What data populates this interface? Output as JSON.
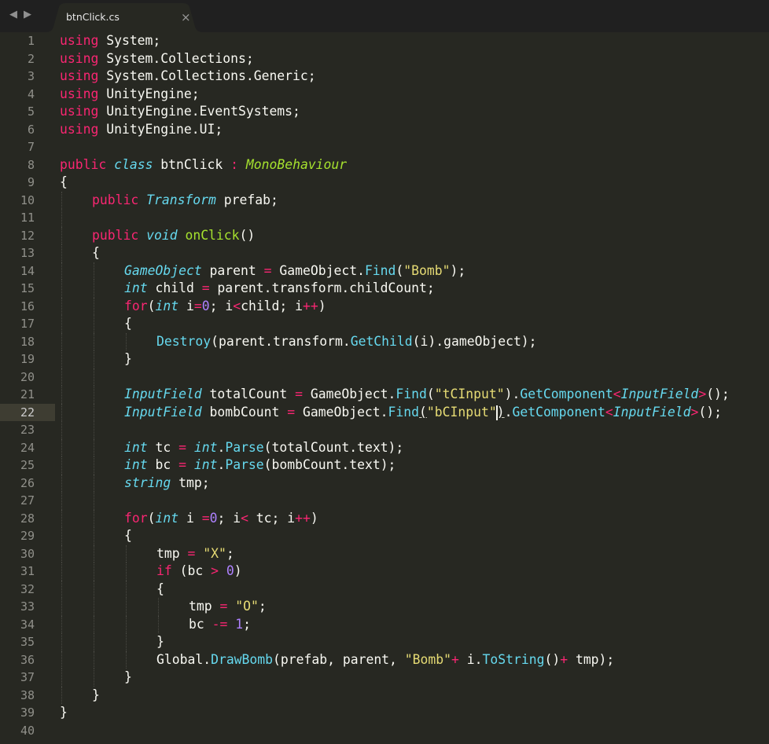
{
  "tabbar": {
    "nav_left_icon": "◀",
    "nav_right_icon": "▶",
    "active_tab": "btnClick.cs",
    "close_glyph": "×"
  },
  "editor": {
    "current_line": 22,
    "lines": [
      {
        "n": "1",
        "indent": 0,
        "tokens": [
          {
            "t": "using",
            "c": "k"
          },
          {
            "t": " System;",
            "c": "p"
          }
        ]
      },
      {
        "n": "2",
        "indent": 0,
        "tokens": [
          {
            "t": "using",
            "c": "k"
          },
          {
            "t": " System.Collections;",
            "c": "p"
          }
        ]
      },
      {
        "n": "3",
        "indent": 0,
        "tokens": [
          {
            "t": "using",
            "c": "k"
          },
          {
            "t": " System.Collections.Generic;",
            "c": "p"
          }
        ]
      },
      {
        "n": "4",
        "indent": 0,
        "tokens": [
          {
            "t": "using",
            "c": "k"
          },
          {
            "t": " UnityEngine;",
            "c": "p"
          }
        ]
      },
      {
        "n": "5",
        "indent": 0,
        "tokens": [
          {
            "t": "using",
            "c": "k"
          },
          {
            "t": " UnityEngine.EventSystems;",
            "c": "p"
          }
        ]
      },
      {
        "n": "6",
        "indent": 0,
        "tokens": [
          {
            "t": "using",
            "c": "k"
          },
          {
            "t": " UnityEngine.UI;",
            "c": "p"
          }
        ]
      },
      {
        "n": "7",
        "indent": 0,
        "tokens": []
      },
      {
        "n": "8",
        "indent": 0,
        "tokens": [
          {
            "t": "public",
            "c": "k"
          },
          {
            "t": " ",
            "c": "p"
          },
          {
            "t": "class",
            "c": "t"
          },
          {
            "t": " btnClick ",
            "c": "p"
          },
          {
            "t": ":",
            "c": "o"
          },
          {
            "t": " ",
            "c": "p"
          },
          {
            "t": "MonoBehaviour",
            "c": "c"
          }
        ]
      },
      {
        "n": "9",
        "indent": 0,
        "tokens": [
          {
            "t": "{",
            "c": "p"
          }
        ]
      },
      {
        "n": "10",
        "indent": 1,
        "tokens": [
          {
            "t": "public",
            "c": "k"
          },
          {
            "t": " ",
            "c": "p"
          },
          {
            "t": "Transform",
            "c": "t"
          },
          {
            "t": " prefab;",
            "c": "p"
          }
        ]
      },
      {
        "n": "11",
        "indent": 1,
        "tokens": []
      },
      {
        "n": "12",
        "indent": 1,
        "tokens": [
          {
            "t": "public",
            "c": "k"
          },
          {
            "t": " ",
            "c": "p"
          },
          {
            "t": "void",
            "c": "t"
          },
          {
            "t": " ",
            "c": "p"
          },
          {
            "t": "onClick",
            "c": "cn"
          },
          {
            "t": "()",
            "c": "p"
          }
        ]
      },
      {
        "n": "13",
        "indent": 1,
        "tokens": [
          {
            "t": "{",
            "c": "p"
          }
        ]
      },
      {
        "n": "14",
        "indent": 2,
        "tokens": [
          {
            "t": "GameObject",
            "c": "t"
          },
          {
            "t": " parent ",
            "c": "p"
          },
          {
            "t": "=",
            "c": "o"
          },
          {
            "t": " GameObject.",
            "c": "p"
          },
          {
            "t": "Find",
            "c": "f"
          },
          {
            "t": "(",
            "c": "p"
          },
          {
            "t": "\"Bomb\"",
            "c": "s"
          },
          {
            "t": ");",
            "c": "p"
          }
        ]
      },
      {
        "n": "15",
        "indent": 2,
        "tokens": [
          {
            "t": "int",
            "c": "t"
          },
          {
            "t": " child ",
            "c": "p"
          },
          {
            "t": "=",
            "c": "o"
          },
          {
            "t": " parent.transform.childCount;",
            "c": "p"
          }
        ]
      },
      {
        "n": "16",
        "indent": 2,
        "tokens": [
          {
            "t": "for",
            "c": "k"
          },
          {
            "t": "(",
            "c": "p"
          },
          {
            "t": "int",
            "c": "t"
          },
          {
            "t": " i",
            "c": "p"
          },
          {
            "t": "=",
            "c": "o"
          },
          {
            "t": "0",
            "c": "n"
          },
          {
            "t": "; i",
            "c": "p"
          },
          {
            "t": "<",
            "c": "o"
          },
          {
            "t": "child; i",
            "c": "p"
          },
          {
            "t": "++",
            "c": "o"
          },
          {
            "t": ")",
            "c": "p"
          }
        ]
      },
      {
        "n": "17",
        "indent": 2,
        "tokens": [
          {
            "t": "{",
            "c": "p"
          }
        ]
      },
      {
        "n": "18",
        "indent": 3,
        "tokens": [
          {
            "t": "Destroy",
            "c": "f"
          },
          {
            "t": "(parent.transform.",
            "c": "p"
          },
          {
            "t": "GetChild",
            "c": "f"
          },
          {
            "t": "(i).gameObject);",
            "c": "p"
          }
        ]
      },
      {
        "n": "19",
        "indent": 2,
        "tokens": [
          {
            "t": "}",
            "c": "p"
          }
        ]
      },
      {
        "n": "20",
        "indent": 2,
        "tokens": []
      },
      {
        "n": "21",
        "indent": 2,
        "tokens": [
          {
            "t": "InputField",
            "c": "t"
          },
          {
            "t": " totalCount ",
            "c": "p"
          },
          {
            "t": "=",
            "c": "o"
          },
          {
            "t": " GameObject.",
            "c": "p"
          },
          {
            "t": "Find",
            "c": "f"
          },
          {
            "t": "(",
            "c": "p"
          },
          {
            "t": "\"tCInput\"",
            "c": "s"
          },
          {
            "t": ").",
            "c": "p"
          },
          {
            "t": "GetComponent",
            "c": "f"
          },
          {
            "t": "<",
            "c": "o"
          },
          {
            "t": "InputField",
            "c": "t"
          },
          {
            "t": ">",
            "c": "o"
          },
          {
            "t": "();",
            "c": "p"
          }
        ]
      },
      {
        "n": "22",
        "indent": 2,
        "tokens": [
          {
            "t": "InputField",
            "c": "t"
          },
          {
            "t": " bombCount ",
            "c": "p"
          },
          {
            "t": "=",
            "c": "o"
          },
          {
            "t": " GameObject.",
            "c": "p"
          },
          {
            "t": "Find",
            "c": "f"
          },
          {
            "t": "(",
            "c": "p ul"
          },
          {
            "t": "\"bCInput\"",
            "c": "s"
          },
          {
            "t": ")",
            "c": "p ul"
          },
          {
            "t": ".",
            "c": "p"
          },
          {
            "t": "GetComponent",
            "c": "f"
          },
          {
            "t": "<",
            "c": "o"
          },
          {
            "t": "InputField",
            "c": "t"
          },
          {
            "t": ">",
            "c": "o"
          },
          {
            "t": "();",
            "c": "p"
          }
        ]
      },
      {
        "n": "23",
        "indent": 2,
        "tokens": []
      },
      {
        "n": "24",
        "indent": 2,
        "tokens": [
          {
            "t": "int",
            "c": "t"
          },
          {
            "t": " tc ",
            "c": "p"
          },
          {
            "t": "=",
            "c": "o"
          },
          {
            "t": " ",
            "c": "p"
          },
          {
            "t": "int",
            "c": "t"
          },
          {
            "t": ".",
            "c": "p"
          },
          {
            "t": "Parse",
            "c": "f"
          },
          {
            "t": "(totalCount.text);",
            "c": "p"
          }
        ]
      },
      {
        "n": "25",
        "indent": 2,
        "tokens": [
          {
            "t": "int",
            "c": "t"
          },
          {
            "t": " bc ",
            "c": "p"
          },
          {
            "t": "=",
            "c": "o"
          },
          {
            "t": " ",
            "c": "p"
          },
          {
            "t": "int",
            "c": "t"
          },
          {
            "t": ".",
            "c": "p"
          },
          {
            "t": "Parse",
            "c": "f"
          },
          {
            "t": "(bombCount.text);",
            "c": "p"
          }
        ]
      },
      {
        "n": "26",
        "indent": 2,
        "tokens": [
          {
            "t": "string",
            "c": "t"
          },
          {
            "t": " tmp;",
            "c": "p"
          }
        ]
      },
      {
        "n": "27",
        "indent": 2,
        "tokens": []
      },
      {
        "n": "28",
        "indent": 2,
        "tokens": [
          {
            "t": "for",
            "c": "k"
          },
          {
            "t": "(",
            "c": "p"
          },
          {
            "t": "int",
            "c": "t"
          },
          {
            "t": " i ",
            "c": "p"
          },
          {
            "t": "=",
            "c": "o"
          },
          {
            "t": "0",
            "c": "n"
          },
          {
            "t": "; i",
            "c": "p"
          },
          {
            "t": "<",
            "c": "o"
          },
          {
            "t": " tc; i",
            "c": "p"
          },
          {
            "t": "++",
            "c": "o"
          },
          {
            "t": ")",
            "c": "p"
          }
        ]
      },
      {
        "n": "29",
        "indent": 2,
        "tokens": [
          {
            "t": "{",
            "c": "p"
          }
        ]
      },
      {
        "n": "30",
        "indent": 3,
        "tokens": [
          {
            "t": "tmp ",
            "c": "p"
          },
          {
            "t": "=",
            "c": "o"
          },
          {
            "t": " ",
            "c": "p"
          },
          {
            "t": "\"X\"",
            "c": "s"
          },
          {
            "t": ";",
            "c": "p"
          }
        ]
      },
      {
        "n": "31",
        "indent": 3,
        "tokens": [
          {
            "t": "if",
            "c": "k"
          },
          {
            "t": " (bc ",
            "c": "p"
          },
          {
            "t": ">",
            "c": "o"
          },
          {
            "t": " ",
            "c": "p"
          },
          {
            "t": "0",
            "c": "n"
          },
          {
            "t": ")",
            "c": "p"
          }
        ]
      },
      {
        "n": "32",
        "indent": 3,
        "tokens": [
          {
            "t": "{",
            "c": "p"
          }
        ]
      },
      {
        "n": "33",
        "indent": 4,
        "tokens": [
          {
            "t": "tmp ",
            "c": "p"
          },
          {
            "t": "=",
            "c": "o"
          },
          {
            "t": " ",
            "c": "p"
          },
          {
            "t": "\"O\"",
            "c": "s"
          },
          {
            "t": ";",
            "c": "p"
          }
        ]
      },
      {
        "n": "34",
        "indent": 4,
        "tokens": [
          {
            "t": "bc ",
            "c": "p"
          },
          {
            "t": "-=",
            "c": "o"
          },
          {
            "t": " ",
            "c": "p"
          },
          {
            "t": "1",
            "c": "n"
          },
          {
            "t": ";",
            "c": "p"
          }
        ]
      },
      {
        "n": "35",
        "indent": 3,
        "tokens": [
          {
            "t": "}",
            "c": "p"
          }
        ]
      },
      {
        "n": "36",
        "indent": 3,
        "tokens": [
          {
            "t": "Global.",
            "c": "p"
          },
          {
            "t": "DrawBomb",
            "c": "f"
          },
          {
            "t": "(prefab, parent, ",
            "c": "p"
          },
          {
            "t": "\"Bomb\"",
            "c": "s"
          },
          {
            "t": "+",
            "c": "o"
          },
          {
            "t": " i.",
            "c": "p"
          },
          {
            "t": "ToString",
            "c": "f"
          },
          {
            "t": "()",
            "c": "p"
          },
          {
            "t": "+",
            "c": "o"
          },
          {
            "t": " tmp);",
            "c": "p"
          }
        ]
      },
      {
        "n": "37",
        "indent": 2,
        "tokens": [
          {
            "t": "}",
            "c": "p"
          }
        ]
      },
      {
        "n": "38",
        "indent": 1,
        "tokens": [
          {
            "t": "}",
            "c": "p"
          }
        ]
      },
      {
        "n": "39",
        "indent": 0,
        "tokens": [
          {
            "t": "}",
            "c": "p"
          }
        ]
      },
      {
        "n": "40",
        "indent": 0,
        "tokens": []
      }
    ]
  }
}
